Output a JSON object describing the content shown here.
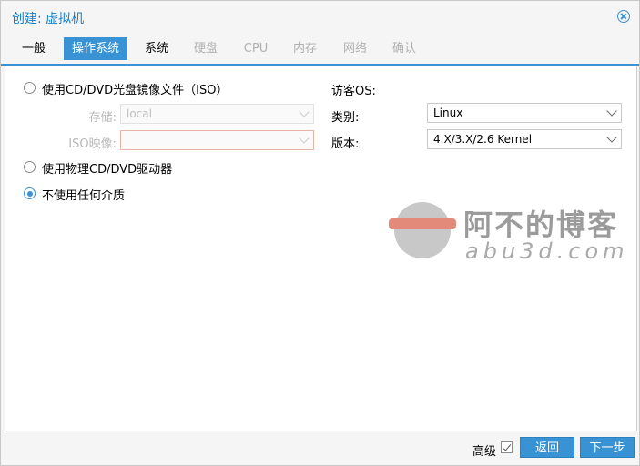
{
  "window": {
    "title": "创建: 虚拟机"
  },
  "tabs": [
    {
      "label": "一般",
      "state": "normal"
    },
    {
      "label": "操作系统",
      "state": "active"
    },
    {
      "label": "系统",
      "state": "normal"
    },
    {
      "label": "硬盘",
      "state": "disabled"
    },
    {
      "label": "CPU",
      "state": "disabled"
    },
    {
      "label": "内存",
      "state": "disabled"
    },
    {
      "label": "网络",
      "state": "disabled"
    },
    {
      "label": "确认",
      "state": "disabled"
    }
  ],
  "media": {
    "option_iso": "使用CD/DVD光盘镜像文件（ISO）",
    "storage_label": "存储:",
    "storage_value": "local",
    "iso_label": "ISO映像:",
    "iso_value": "",
    "option_physical": "使用物理CD/DVD驱动器",
    "option_none": "不使用任何介质",
    "selected": "option_none"
  },
  "guest": {
    "heading": "访客OS:",
    "type_label": "类别:",
    "type_value": "Linux",
    "version_label": "版本:",
    "version_value": "4.X/3.X/2.6 Kernel"
  },
  "watermark": {
    "text": "阿不的博客",
    "sub": "abu3d.com"
  },
  "footer": {
    "advanced_label": "高级",
    "advanced_checked": true,
    "back_label": "返回",
    "next_label": "下一步"
  },
  "colors": {
    "accent": "#3892d4",
    "title": "#157fcc"
  }
}
